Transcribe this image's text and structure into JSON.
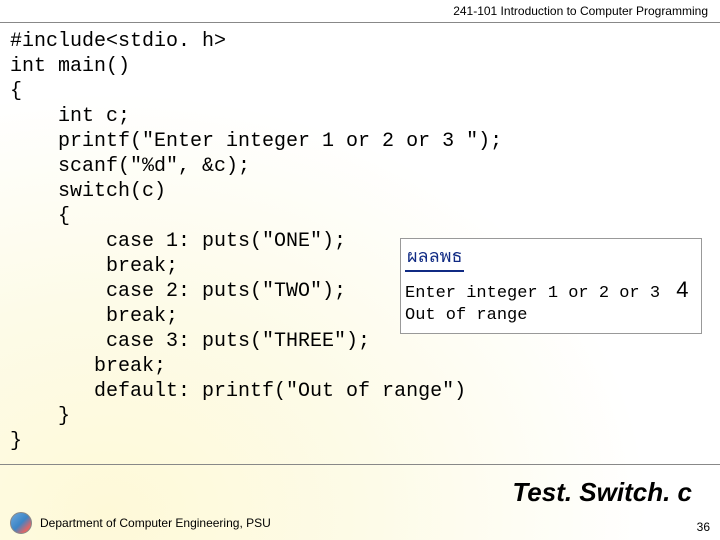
{
  "header": {
    "course": "241-101 Introduction to Computer Programming"
  },
  "code": {
    "text": "#include<stdio. h>\nint main()\n{\n    int c;\n    printf(\"Enter integer 1 or 2 or 3 \");\n    scanf(\"%d\", &c);\n    switch(c)\n    {\n        case 1: puts(\"ONE\");\n        break;\n        case 2: puts(\"TWO\");\n        break;\n        case 3: puts(\"THREE\");\n       break;\n       default: printf(\"Out of range\")\n    }\n}"
  },
  "output": {
    "label": "ผลลพธ",
    "line1_prompt": "Enter integer 1 or 2 or 3 ",
    "line1_input": "4",
    "line2": "Out of range"
  },
  "filename": "Test. Switch. c",
  "footer": {
    "dept": "Department of Computer Engineering, PSU"
  },
  "page": "36"
}
